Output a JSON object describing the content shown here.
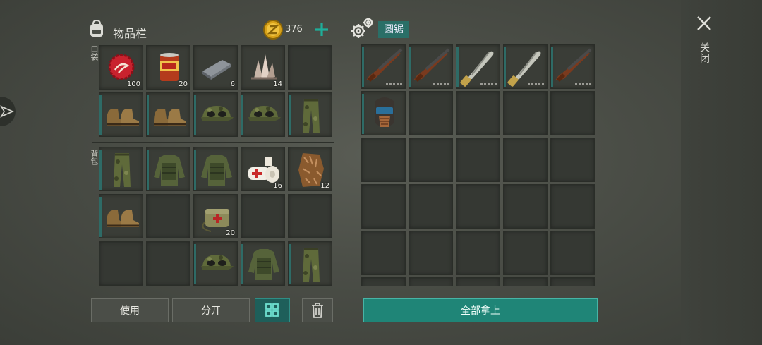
{
  "header": {
    "title": "物品栏",
    "coins": "376",
    "saw_title": "圆锯",
    "close_label": "关闭"
  },
  "sections": {
    "pocket_label": "口袋",
    "backpack_label": "背包"
  },
  "pocket": [
    {
      "icon": "bottle-cap-icon",
      "count": "100"
    },
    {
      "icon": "canned-food-icon",
      "count": "20"
    },
    {
      "icon": "iron-bar-icon",
      "count": "6"
    },
    {
      "icon": "quartz-crystal-icon",
      "count": "14"
    },
    {
      "icon": "",
      "count": ""
    },
    {
      "icon": "boots-icon",
      "count": ""
    },
    {
      "icon": "boots-icon",
      "count": ""
    },
    {
      "icon": "camo-cap-icon",
      "count": ""
    },
    {
      "icon": "camo-cap-icon",
      "count": ""
    },
    {
      "icon": "camo-pants-icon",
      "count": ""
    }
  ],
  "backpack": [
    {
      "icon": "camo-pants-icon",
      "count": ""
    },
    {
      "icon": "armored-jacket-icon",
      "count": ""
    },
    {
      "icon": "armored-jacket-icon",
      "count": ""
    },
    {
      "icon": "bandage-icon",
      "count": "16"
    },
    {
      "icon": "fur-pelt-icon",
      "count": "12"
    },
    {
      "icon": "boots-icon",
      "count": ""
    },
    {
      "icon": "",
      "count": ""
    },
    {
      "icon": "medkit-bag-icon",
      "count": "20"
    },
    {
      "icon": "",
      "count": ""
    },
    {
      "icon": "",
      "count": ""
    },
    {
      "icon": "",
      "count": ""
    },
    {
      "icon": "",
      "count": ""
    },
    {
      "icon": "camo-cap-icon",
      "count": ""
    },
    {
      "icon": "armored-jacket-icon",
      "count": ""
    },
    {
      "icon": "camo-pants-icon",
      "count": ""
    }
  ],
  "saw_items": [
    {
      "icon": "shotgun-icon"
    },
    {
      "icon": "shotgun-icon"
    },
    {
      "icon": "machete-icon"
    },
    {
      "icon": "machete-icon"
    },
    {
      "icon": "shotgun-icon"
    },
    {
      "icon": "welding-mask-icon"
    }
  ],
  "buttons": {
    "use": "使用",
    "split": "分开",
    "sort_icon": "grid-sort-icon",
    "trash_icon": "trash-icon",
    "take_all": "全部拿上"
  }
}
